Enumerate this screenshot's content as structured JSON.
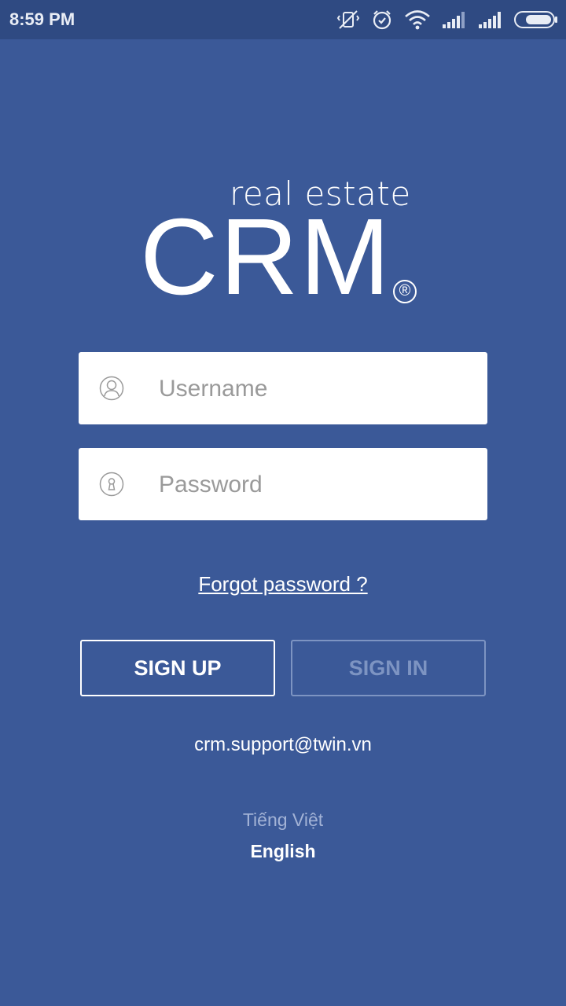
{
  "status_bar": {
    "time": "8:59 PM",
    "icons": [
      "vibrate-off-icon",
      "alarm-icon",
      "wifi-icon",
      "signal-icon",
      "signal-icon",
      "battery-icon"
    ]
  },
  "logo": {
    "small_text": "real estate",
    "big_text": "CRM",
    "registered": "®"
  },
  "form": {
    "username_placeholder": "Username",
    "username_value": "",
    "username_icon": "user-icon",
    "password_placeholder": "Password",
    "password_value": "",
    "password_icon": "keyhole-icon"
  },
  "forgot_password": "Forgot password ?",
  "buttons": {
    "sign_up": "SIGN UP",
    "sign_in": "SIGN IN"
  },
  "support_email": "crm.support@twin.vn",
  "languages": {
    "vietnamese": "Tiếng Việt",
    "english": "English"
  },
  "colors": {
    "background": "#3b5998",
    "status_bar": "#2f4a82",
    "disabled": "#7d94c2"
  }
}
